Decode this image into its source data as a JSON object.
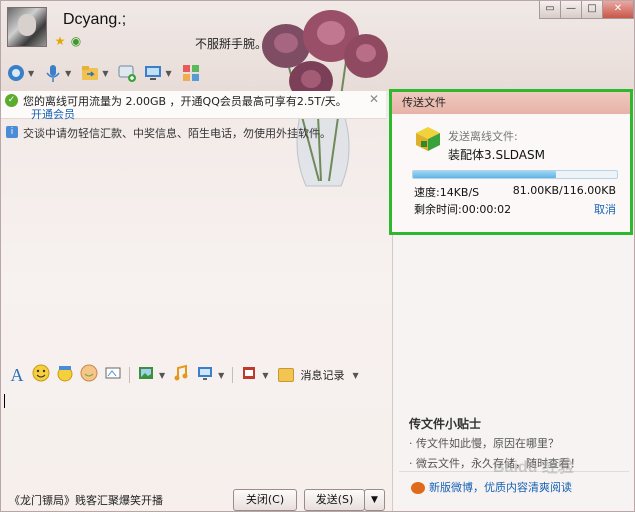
{
  "window": {
    "controls": [
      "▭",
      "—",
      "□",
      "✕"
    ]
  },
  "profile": {
    "nickname": "Dcyang.;",
    "signature": "不服掰手腕。"
  },
  "toolbar": {
    "icons": [
      "video-icon",
      "mic-icon",
      "folder-transfer-icon",
      "add-chat-icon",
      "remote-desktop-icon",
      "apps-icon"
    ]
  },
  "notifications": {
    "offline_quota": "您的离线可用流量为 2.00GB ，开通QQ会员最高可享有2.5T/天。",
    "offline_quota_link": "开通会员",
    "close_glyph": "✕",
    "security_tip": "交谈中请勿轻信汇款、中奖信息、陌生电话，勿使用外挂软件。"
  },
  "transfer": {
    "header": "传送文件",
    "label": "发送离线文件:",
    "filename": "装配体3.SLDASM",
    "progress_fraction": 0.7,
    "speed": "速度:14KB/S",
    "size": "81.00KB/116.00KB",
    "remaining": "剩余时间:00:00:02",
    "cancel": "取消"
  },
  "tips": {
    "title": "传文件小贴士",
    "items": [
      "· 传文件如此慢，原因在哪里？",
      "· 微云文件，永久存储，随时查看！"
    ],
    "weibo": "新版微博，优质内容清爽阅读"
  },
  "input_toolbar": {
    "history": "消息记录"
  },
  "bottom": {
    "ad": "《龙门镖局》贱客汇聚爆笑开播",
    "close_label": "关闭(C)",
    "send_label": "发送(S)",
    "send_arrow": "▼"
  },
  "watermark": "Baidu 经验",
  "colors": {
    "highlight_border": "#2db82d",
    "link": "#1762b5",
    "transfer_header": "#e7b3a6"
  }
}
